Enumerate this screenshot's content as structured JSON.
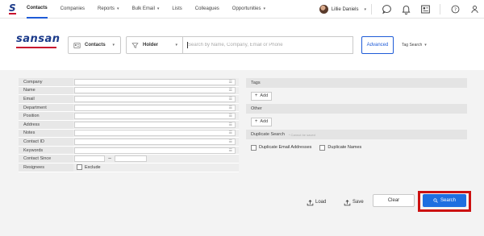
{
  "nav": {
    "items": [
      {
        "label": "Contacts",
        "dropdown": false,
        "active": true
      },
      {
        "label": "Companies",
        "dropdown": false,
        "active": false
      },
      {
        "label": "Reports",
        "dropdown": true,
        "active": false
      },
      {
        "label": "Bulk Email",
        "dropdown": true,
        "active": false
      },
      {
        "label": "Lists",
        "dropdown": false,
        "active": false
      },
      {
        "label": "Colleagues",
        "dropdown": false,
        "active": false
      },
      {
        "label": "Opportunities",
        "dropdown": true,
        "active": false
      }
    ],
    "user_name": "Lillie Daniels",
    "icons": [
      "chat-icon",
      "bell-icon",
      "id-card-icon",
      "help-icon",
      "person-icon"
    ]
  },
  "header": {
    "brand": "sansan",
    "scope_select": "Contacts",
    "filter_select": "Holder",
    "search_placeholder": "Search by Name, Company, Email or Phone",
    "advanced_label": "Advanced",
    "tag_search_label": "Tag Search"
  },
  "form": {
    "fields": [
      {
        "label": "Company"
      },
      {
        "label": "Name"
      },
      {
        "label": "Email"
      },
      {
        "label": "Department"
      },
      {
        "label": "Position"
      },
      {
        "label": "Address"
      },
      {
        "label": "Notes"
      },
      {
        "label": "Contact ID"
      },
      {
        "label": "Keywords"
      }
    ],
    "contact_since_label": "Contact Since",
    "range_separator": "~",
    "resignees_label": "Resignees",
    "exclude_label": "Exclude"
  },
  "right_panel": {
    "tags_heading": "Tags",
    "tags_add": "Add",
    "other_heading": "Other",
    "other_add": "Add",
    "duplicate_heading": "Duplicate Search",
    "duplicate_note": "* Cannot be saved",
    "duplicate_emails": "Duplicate Email Addresses",
    "duplicate_names": "Duplicate Names"
  },
  "actions": {
    "load_label": "Load",
    "save_label": "Save",
    "clear_label": "Clear",
    "search_label": "Search"
  },
  "colors": {
    "brand_blue": "#1b3a8a",
    "brand_red": "#c8102e",
    "accent": "#1e6fe0",
    "highlight": "#cc1111"
  }
}
